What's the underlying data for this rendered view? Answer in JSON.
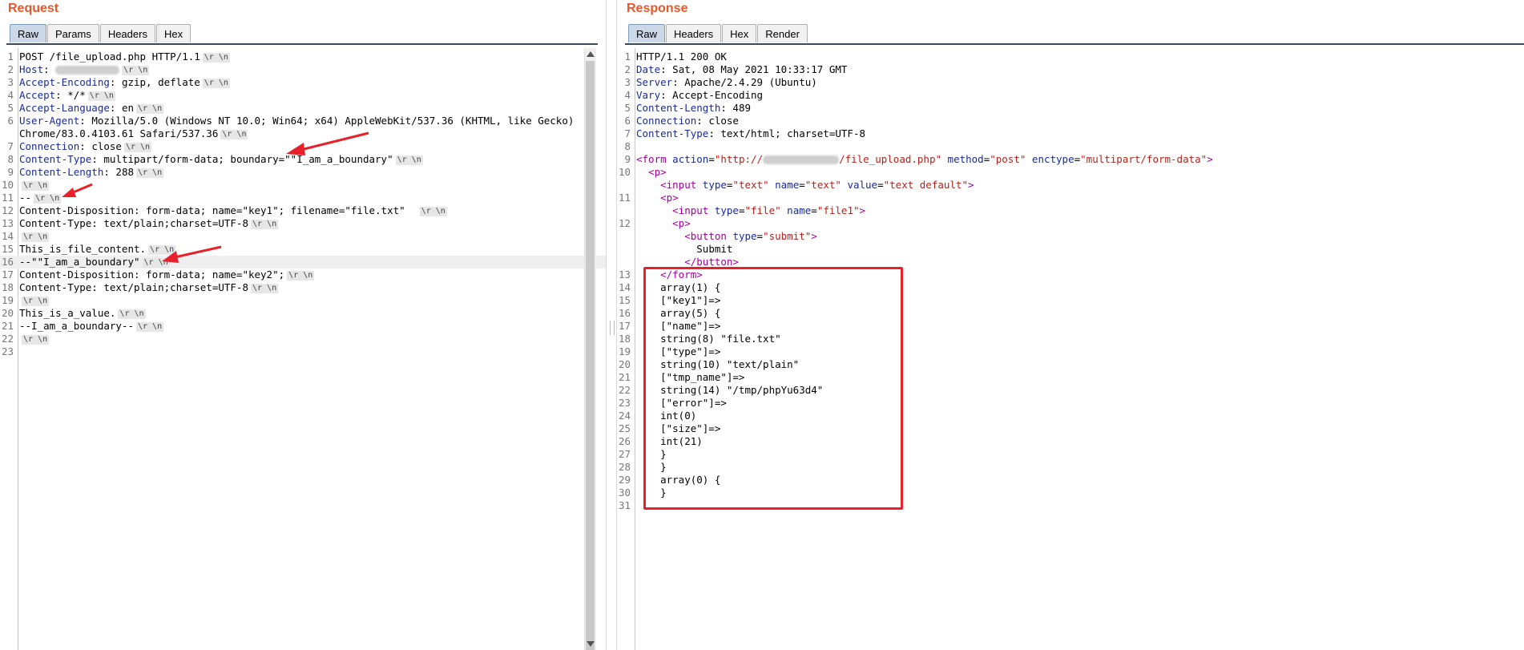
{
  "request": {
    "title": "Request",
    "tabs": [
      "Raw",
      "Params",
      "Headers",
      "Hex"
    ],
    "active_tab": "Raw",
    "lines": [
      {
        "n": "1",
        "name": "",
        "text": "POST /file_upload.php HTTP/1.1",
        "crlf": true
      },
      {
        "n": "2",
        "name": "Host",
        "text": "",
        "crlf": true,
        "blur": true
      },
      {
        "n": "3",
        "name": "Accept-Encoding",
        "text": "gzip, deflate",
        "crlf": true
      },
      {
        "n": "4",
        "name": "Accept",
        "text": "*/*",
        "crlf": true
      },
      {
        "n": "5",
        "name": "Accept-Language",
        "text": "en",
        "crlf": true
      },
      {
        "n": "6",
        "name": "User-Agent",
        "text": "Mozilla/5.0 (Windows NT 10.0; Win64; x64) AppleWebKit/537.36 (KHTML, like Gecko)",
        "crlf": false
      },
      {
        "n": "",
        "name": "",
        "text": "Chrome/83.0.4103.61 Safari/537.36",
        "crlf": true
      },
      {
        "n": "7",
        "name": "Connection",
        "text": "close",
        "crlf": true
      },
      {
        "n": "8",
        "name": "Content-Type",
        "text": "multipart/form-data; boundary=\"\"I_am_a_boundary\"",
        "crlf": true
      },
      {
        "n": "9",
        "name": "Content-Length",
        "text": "288",
        "crlf": true
      },
      {
        "n": "10",
        "name": "",
        "text": "",
        "crlf": true
      },
      {
        "n": "11",
        "name": "",
        "text": "--",
        "crlf": true
      },
      {
        "n": "12",
        "name": "",
        "text": "Content-Disposition: form-data; name=\"key1\"; filename=\"file.txt\"  ",
        "crlf": true
      },
      {
        "n": "13",
        "name": "",
        "text": "Content-Type: text/plain;charset=UTF-8",
        "crlf": true
      },
      {
        "n": "14",
        "name": "",
        "text": "",
        "crlf": true
      },
      {
        "n": "15",
        "name": "",
        "text": "This_is_file_content.",
        "crlf": true
      },
      {
        "n": "16",
        "name": "",
        "text": "--\"\"I_am_a_boundary\"",
        "crlf": true,
        "hl": true
      },
      {
        "n": "17",
        "name": "",
        "text": "Content-Disposition: form-data; name=\"key2\";",
        "crlf": true
      },
      {
        "n": "18",
        "name": "",
        "text": "Content-Type: text/plain;charset=UTF-8",
        "crlf": true
      },
      {
        "n": "19",
        "name": "",
        "text": "",
        "crlf": true
      },
      {
        "n": "20",
        "name": "",
        "text": "This_is_a_value.",
        "crlf": true
      },
      {
        "n": "21",
        "name": "",
        "text": "--I_am_a_boundary--",
        "crlf": true
      },
      {
        "n": "22",
        "name": "",
        "text": "",
        "crlf": true
      },
      {
        "n": "23",
        "name": "",
        "text": "",
        "crlf": false
      }
    ]
  },
  "response": {
    "title": "Response",
    "tabs": [
      "Raw",
      "Headers",
      "Hex",
      "Render"
    ],
    "active_tab": "Raw",
    "header_lines": [
      {
        "n": "1",
        "name": "",
        "text": "HTTP/1.1 200 OK"
      },
      {
        "n": "2",
        "name": "Date",
        "text": "Sat, 08 May 2021 10:33:17 GMT"
      },
      {
        "n": "3",
        "name": "Server",
        "text": "Apache/2.4.29 (Ubuntu)"
      },
      {
        "n": "4",
        "name": "Vary",
        "text": "Accept-Encoding"
      },
      {
        "n": "5",
        "name": "Content-Length",
        "text": "489"
      },
      {
        "n": "6",
        "name": "Connection",
        "text": "close"
      },
      {
        "n": "7",
        "name": "Content-Type",
        "text": "text/html; charset=UTF-8"
      },
      {
        "n": "8",
        "name": "",
        "text": ""
      }
    ],
    "form_action_prefix": "http://",
    "form_action_suffix": "/file_upload.php",
    "body_lines": [
      {
        "n": "13",
        "text": "    </form>"
      },
      {
        "n": "14",
        "text": "    array(1) {"
      },
      {
        "n": "15",
        "text": "    [\"key1\"]=>"
      },
      {
        "n": "16",
        "text": "    array(5) {"
      },
      {
        "n": "17",
        "text": "    [\"name\"]=>"
      },
      {
        "n": "18",
        "text": "    string(8) \"file.txt\""
      },
      {
        "n": "19",
        "text": "    [\"type\"]=>"
      },
      {
        "n": "20",
        "text": "    string(10) \"text/plain\""
      },
      {
        "n": "21",
        "text": "    [\"tmp_name\"]=>"
      },
      {
        "n": "22",
        "text": "    string(14) \"/tmp/phpYu63d4\""
      },
      {
        "n": "23",
        "text": "    [\"error\"]=>"
      },
      {
        "n": "24",
        "text": "    int(0)"
      },
      {
        "n": "25",
        "text": "    [\"size\"]=>"
      },
      {
        "n": "26",
        "text": "    int(21)"
      },
      {
        "n": "27",
        "text": "    }"
      },
      {
        "n": "28",
        "text": "    }"
      },
      {
        "n": "29",
        "text": "    array(0) {"
      },
      {
        "n": "30",
        "text": "    }"
      },
      {
        "n": "31",
        "text": ""
      }
    ],
    "html": {
      "form_tag": "form",
      "action_attr": "action",
      "method_attr": "method",
      "method_val": "\"post\"",
      "enctype_attr": "enctype",
      "enctype_val": "\"multipart/form-data\"",
      "p_tag": "p",
      "input_tag": "input",
      "type_attr": "type",
      "name_attr": "name",
      "value_attr": "value",
      "text_type": "\"text\"",
      "text_name": "\"text\"",
      "text_value": "\"text default\"",
      "file_type": "\"file\"",
      "file_name": "\"file1\"",
      "button_tag": "button",
      "submit_type": "\"submit\"",
      "submit_label": "Submit"
    },
    "crlf_label": "\\r \\n"
  },
  "colors": {
    "accent": "#e8582a",
    "highlight": "#e8202a",
    "header_name": "#1b2a96",
    "tag": "#a0009a",
    "attr_value": "#b0241d"
  }
}
